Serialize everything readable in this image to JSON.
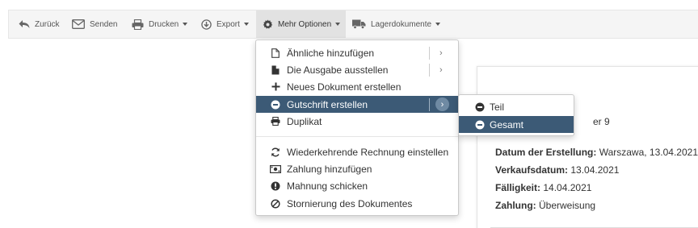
{
  "toolbar": {
    "back_label": "Zurück",
    "send_label": "Senden",
    "print_label": "Drucken",
    "export_label": "Export",
    "more_label": "Mehr Optionen",
    "warehouse_label": "Lagerdokumente"
  },
  "menu": {
    "items": [
      {
        "label": "Ähnliche hinzufügen",
        "icon": "document-outline-icon"
      },
      {
        "label": "Die Ausgabe ausstellen",
        "icon": "document-filled-icon"
      },
      {
        "label": "Neues Dokument erstellen",
        "icon": "plus-icon"
      },
      {
        "label": "Gutschrift erstellen",
        "icon": "minus-circle-icon"
      },
      {
        "label": "Duplikat",
        "icon": "print-icon"
      },
      {
        "label": "Wiederkehrende Rechnung einstellen",
        "icon": "refresh-icon"
      },
      {
        "label": "Zahlung hinzufügen",
        "icon": "money-icon"
      },
      {
        "label": "Mahnung schicken",
        "icon": "exclamation-circle-icon"
      },
      {
        "label": "Stornierung des Dokumentes",
        "icon": "ban-icon"
      }
    ]
  },
  "submenu": {
    "items": [
      {
        "label": "Teil",
        "icon": "minus-circle-icon"
      },
      {
        "label": "Gesamt",
        "icon": "minus-circle-icon"
      }
    ]
  },
  "document": {
    "partial_number": "er 9",
    "created_label": "Datum der Erstellung:",
    "created_value": "Warszawa, 13.04.2021",
    "sale_label": "Verkaufsdatum:",
    "sale_value": "13.04.2021",
    "due_label": "Fälligkeit:",
    "due_value": "14.04.2021",
    "payment_label": "Zahlung:",
    "payment_value": "Überweisung"
  },
  "colors": {
    "active_bg": "#3c5a76",
    "toolbar_bg": "#f5f5f5"
  }
}
